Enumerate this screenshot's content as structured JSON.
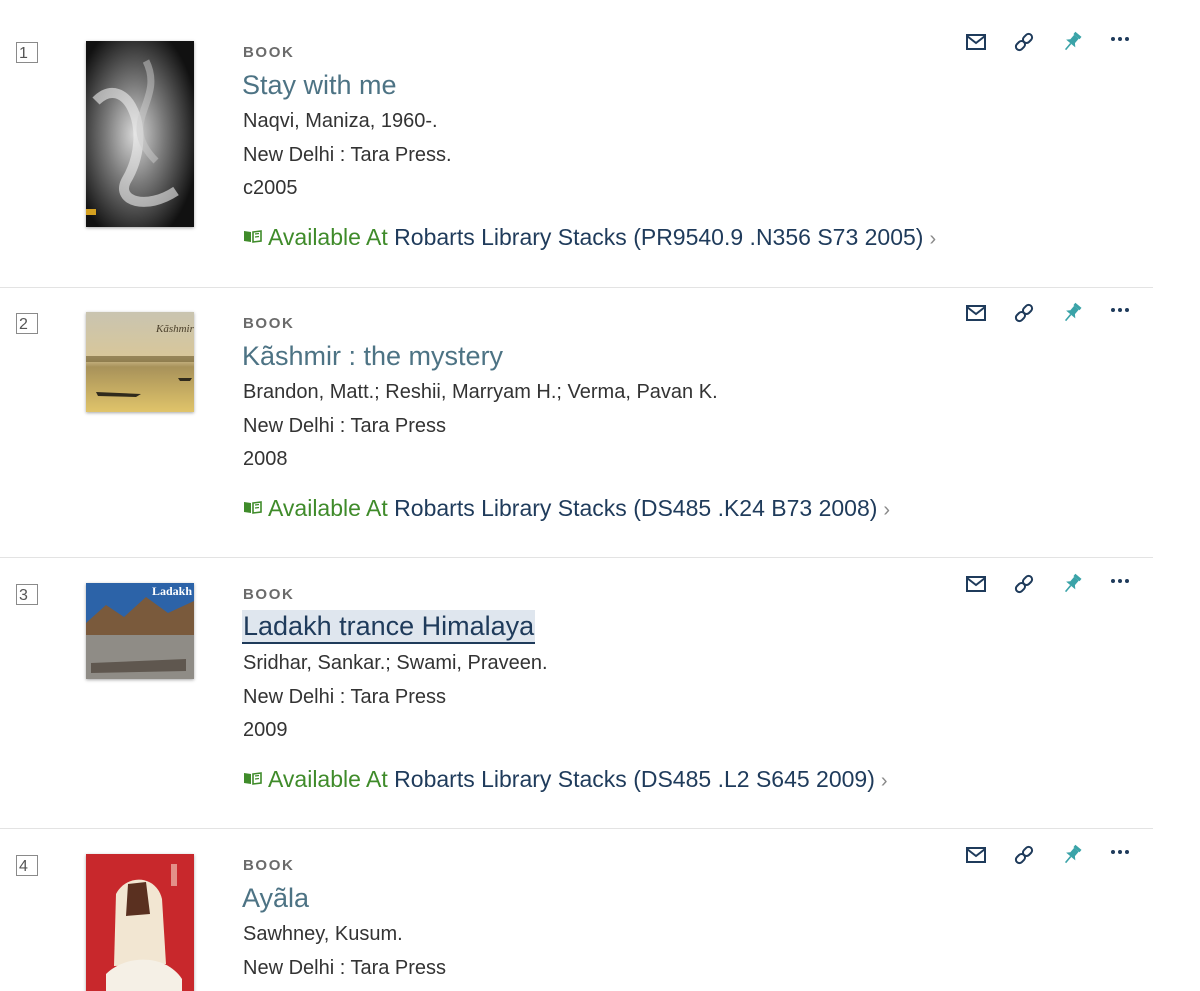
{
  "colors": {
    "title": "#4d7384",
    "available": "#3f8b2a",
    "location": "#1f3b5b",
    "pin": "#3aa3a8",
    "highlight_bg": "#dfe6ee"
  },
  "icons": {
    "email": "envelope-icon",
    "permalink": "link-icon",
    "pin": "pushpin-icon",
    "more": "ellipsis-icon",
    "availability": "open-book-icon",
    "chevron": "chevron-right-icon"
  },
  "records": [
    {
      "number": "1",
      "type": "BOOK",
      "title": "Stay with me",
      "author": "Naqvi, Maniza, 1960-.",
      "publisher": "New Delhi : Tara Press.",
      "date": "c2005",
      "availability": "Available At",
      "location": "Robarts Library  Stacks (PR9540.9 .N356 S73 2005)",
      "chevron": "›"
    },
    {
      "number": "2",
      "type": "BOOK",
      "title": "Kãshmir : the mystery",
      "author": "Brandon, Matt.; Reshii, Marryam H.; Verma, Pavan K.",
      "publisher": "New Delhi : Tara Press",
      "date": "2008",
      "availability": "Available At",
      "location": "Robarts Library  Stacks (DS485 .K24 B73 2008)",
      "chevron": "›"
    },
    {
      "number": "3",
      "type": "BOOK",
      "title": "Ladakh trance Himalaya",
      "author": "Sridhar, Sankar.; Swami, Praveen.",
      "publisher": "New Delhi : Tara Press",
      "date": "2009",
      "availability": "Available At",
      "location": "Robarts Library  Stacks (DS485 .L2 S645 2009)",
      "chevron": "›"
    },
    {
      "number": "4",
      "type": "BOOK",
      "title": "Ayãla",
      "author": "Sawhney, Kusum.",
      "publisher": "New Delhi : Tara Press"
    }
  ]
}
